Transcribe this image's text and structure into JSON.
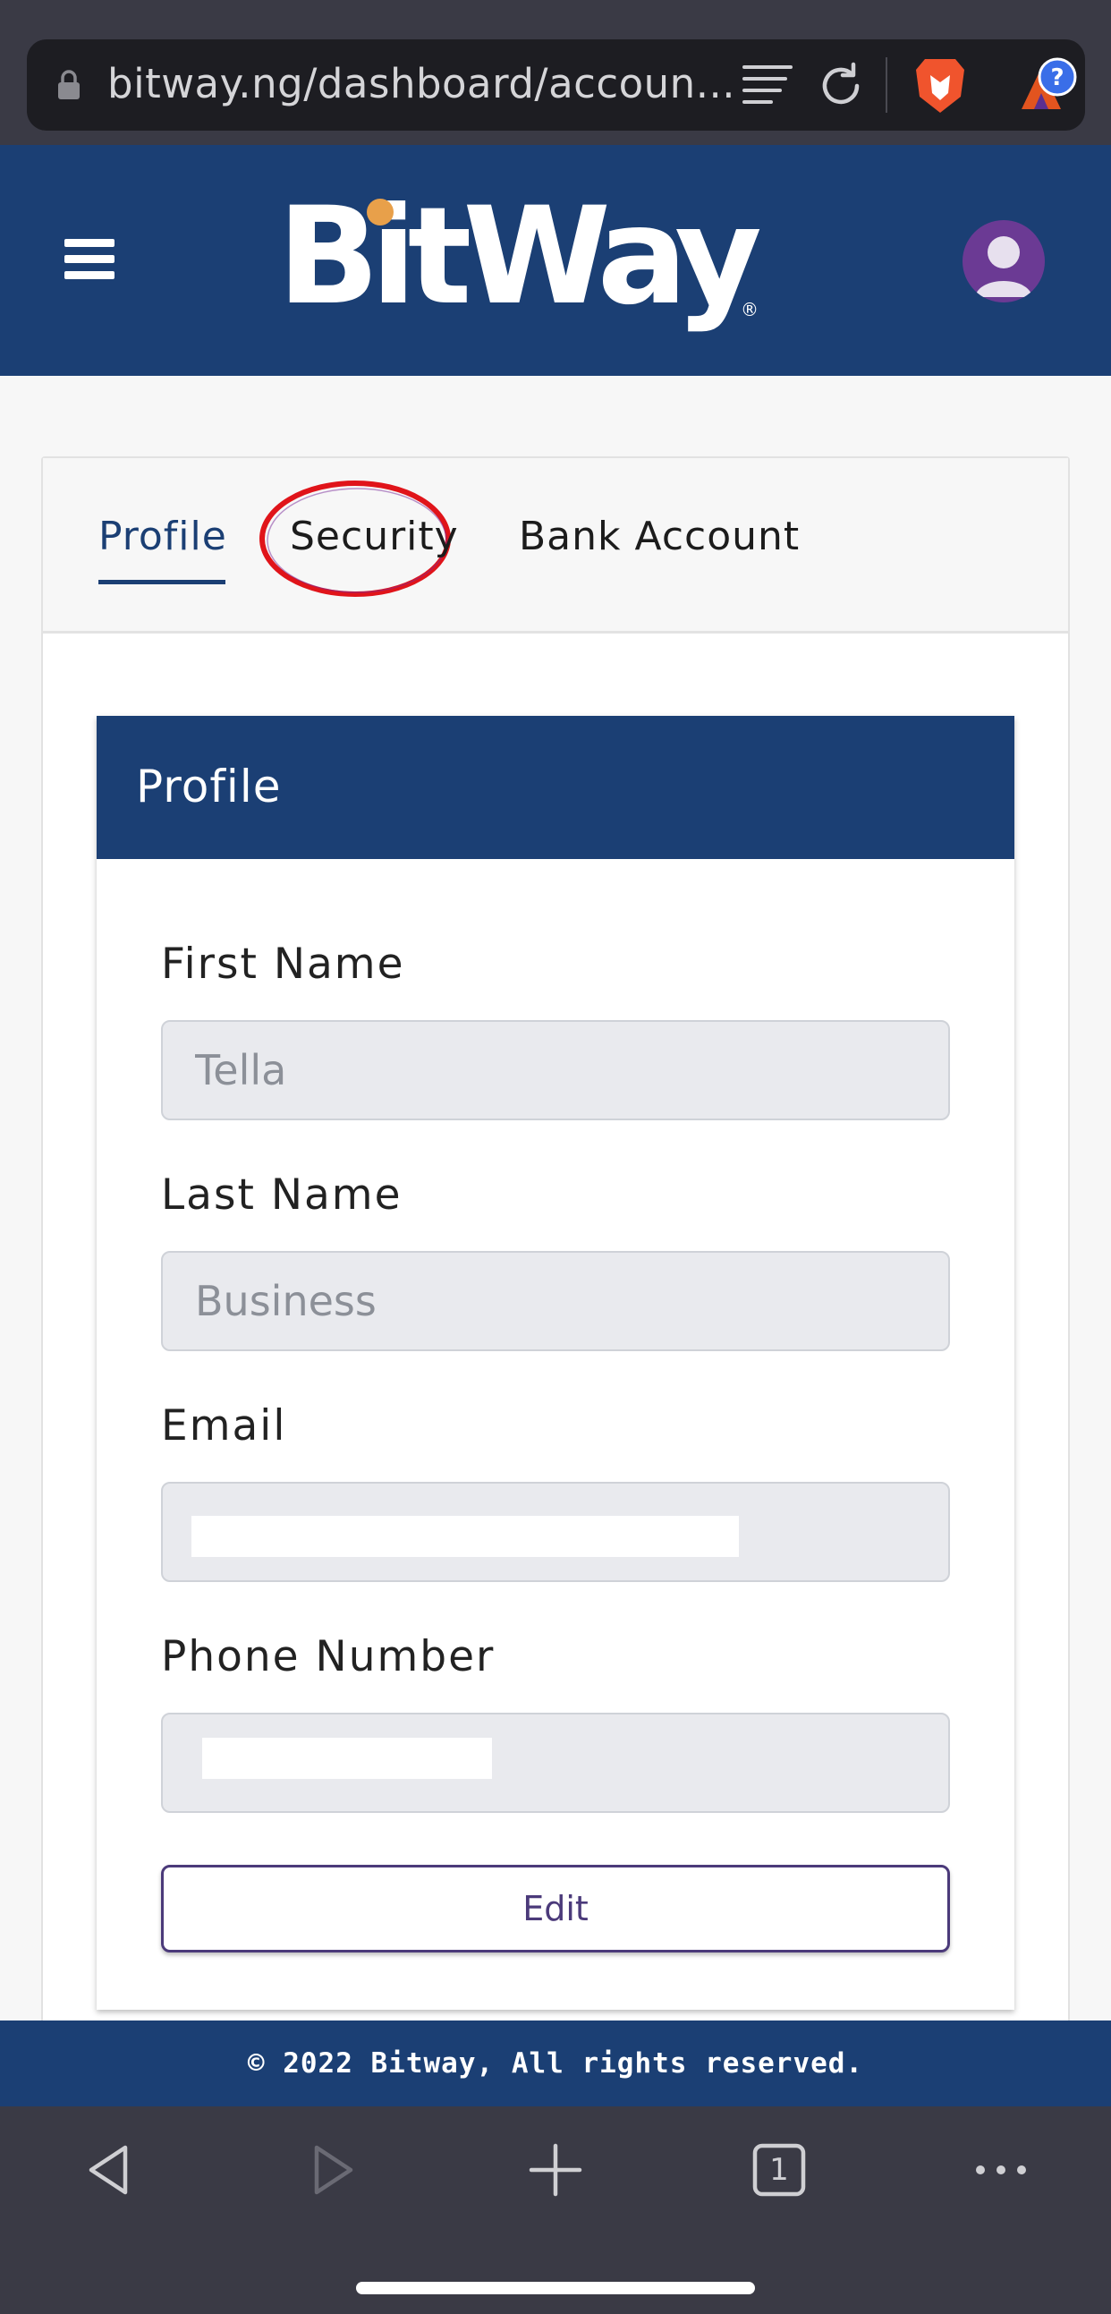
{
  "browser": {
    "url": "bitway.ng/dashboard/accoun...",
    "icons": [
      "lock-icon",
      "reader-icon",
      "reload-icon",
      "brave-lion-icon",
      "bat-rewards-icon"
    ]
  },
  "header": {
    "logo_text": "BitWay",
    "logo_mark": "®",
    "colors": {
      "brand": "#1b3f74",
      "accent": "#e8a04a",
      "avatar": "#6b3a94"
    }
  },
  "tabs": [
    {
      "label": "Profile",
      "active": true
    },
    {
      "label": "Security",
      "active": false
    },
    {
      "label": "Bank Account",
      "active": false
    }
  ],
  "profile": {
    "title": "Profile",
    "fields": [
      {
        "label": "First Name",
        "value": "Tella"
      },
      {
        "label": "Last Name",
        "value": "Business"
      },
      {
        "label": "Email",
        "value": ""
      },
      {
        "label": "Phone Number",
        "value": ""
      }
    ],
    "edit_label": "Edit"
  },
  "footer": {
    "text": "© 2022 Bitway, All rights reserved."
  },
  "browser_nav": {
    "tab_count": "1",
    "icons": [
      "back-icon",
      "forward-icon",
      "new-tab-icon",
      "tabs-icon",
      "more-icon"
    ]
  }
}
